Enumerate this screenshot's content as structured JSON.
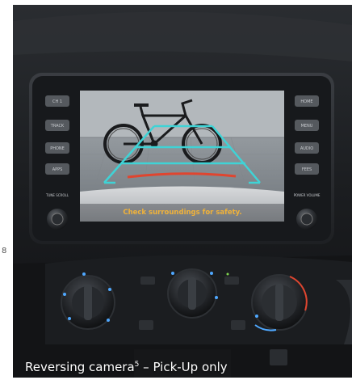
{
  "page": {
    "page_number": "8"
  },
  "photo": {
    "subject": "vehicle-infotainment-display-reversing-camera"
  },
  "screen": {
    "left_buttons": [
      "CH 1",
      "TRACK",
      "PHONE",
      "APPS",
      "TUNE SCROLL"
    ],
    "right_buttons": [
      "HOME",
      "MENU",
      "AUDIO",
      "FEES",
      "POWER VOLUME"
    ],
    "overlay_warning": "Check surroundings for safety."
  },
  "caption": {
    "text_main": "Reversing camera",
    "footnote": "5",
    "text_suffix": " – Pick-Up only"
  },
  "colors": {
    "guide_line": "#3fd3d6",
    "stop_line": "#e0452f",
    "warning_text": "#f0b23a",
    "console_dark": "#15171a"
  }
}
